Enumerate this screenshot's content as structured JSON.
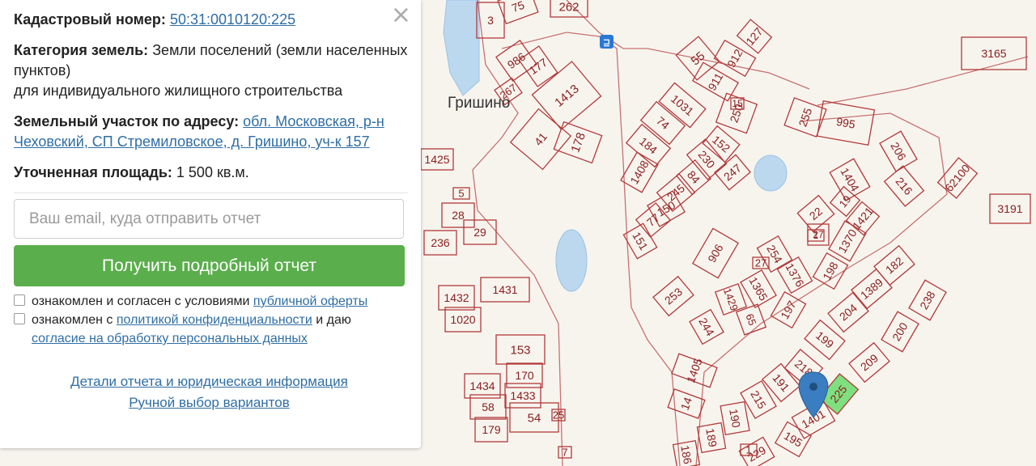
{
  "panel": {
    "close_symbol": "×",
    "cadastral": {
      "label": "Кадастровый номер:",
      "value": "50:31:0010120:225"
    },
    "category": {
      "label": "Категория земель:",
      "value": "Земли поселений (земли населенных пунктов)",
      "usage": "для индивидуального жилищного строительства"
    },
    "address": {
      "label": "Земельный участок по адресу:",
      "value": "обл. Московская, р-н Чеховский, СП Стремиловское, д. Гришино, уч-к 157"
    },
    "area": {
      "label": "Уточненная площадь:",
      "value": "1 500 кв.м."
    },
    "email_placeholder": "Ваш email, куда отправить отчет",
    "submit_label": "Получить подробный отчет",
    "offer": {
      "prefix": "ознакомлен и согласен с условиями",
      "link": "публичной оферты"
    },
    "privacy": {
      "prefix": "ознакомлен с",
      "link": "политикой конфиденциальности",
      "suffix": "и даю",
      "consent_link": "согласие на обработку персональных данных"
    },
    "footer": {
      "details_link": "Детали отчета и юридическая информация",
      "manual_link": "Ручной выбор вариантов"
    }
  },
  "map": {
    "colors": {
      "background": "#f7f4ee",
      "parcel_stroke": "#b23a3a",
      "parcel_label": "#8a2020",
      "water": "#bcd8ef",
      "selected": "#7fe07f",
      "marker": "#3a7dc0"
    },
    "place_name": "Гришино",
    "marker_icon": "map-marker-icon",
    "bus_stop_icon": "bus-stop-icon",
    "parcels": [
      "75",
      "262",
      "3",
      "986",
      "177",
      "267",
      "1413",
      "41",
      "178",
      "1425",
      "55",
      "911",
      "912",
      "127",
      "3165",
      "1031",
      "74",
      "184",
      "250",
      "255",
      "995",
      "1408",
      "230",
      "152",
      "84",
      "247",
      "206",
      "216",
      "62100",
      "3191",
      "245",
      "150",
      "77",
      "151",
      "1404",
      "19",
      "1421",
      "22",
      "1370",
      "27",
      "28",
      "29",
      "236",
      "1431",
      "1432",
      "1020",
      "153",
      "170",
      "1434",
      "1433",
      "58",
      "54",
      "179",
      "906",
      "253",
      "254",
      "1376",
      "198",
      "182",
      "1389",
      "1365",
      "1429",
      "65",
      "244",
      "197",
      "204",
      "238",
      "199",
      "200",
      "209",
      "218",
      "191",
      "215",
      "190",
      "189",
      "186",
      "195",
      "229",
      "225",
      "1401",
      "1405",
      "14",
      "5",
      "7",
      "25",
      "27",
      "1",
      "15",
      "1"
    ]
  }
}
